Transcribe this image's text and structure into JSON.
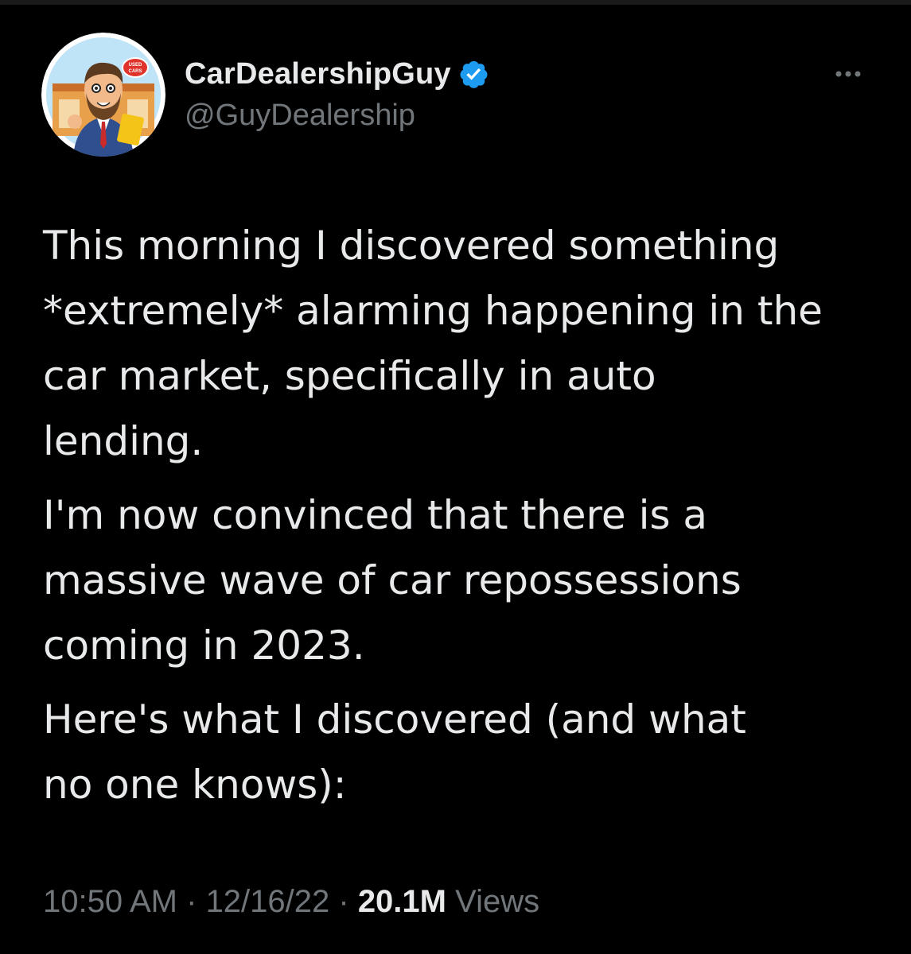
{
  "author": {
    "display_name": "CarDealershipGuy",
    "handle": "@GuyDealership",
    "verified": true,
    "avatar_badge_text": "USED CARS"
  },
  "tweet": {
    "paragraphs": [
      "This morning I discovered something\n*extremely* alarming happening in the\ncar market, specifically in auto\nlending.",
      "I'm now convinced that there is a\nmassive wave of car repossessions\ncoming in 2023.",
      "Here's what I discovered (and what\nno one knows):"
    ]
  },
  "meta": {
    "time": "10:50 AM",
    "separator": " · ",
    "date": "12/16/22",
    "views_count": "20.1M",
    "views_label": "Views"
  },
  "icons": {
    "more": "more-horizontal-icon",
    "verified": "verified-badge-icon"
  },
  "colors": {
    "background": "#000000",
    "text_primary": "#e7e9ea",
    "text_secondary": "#71767b",
    "verified_blue": "#1d9bf0"
  }
}
